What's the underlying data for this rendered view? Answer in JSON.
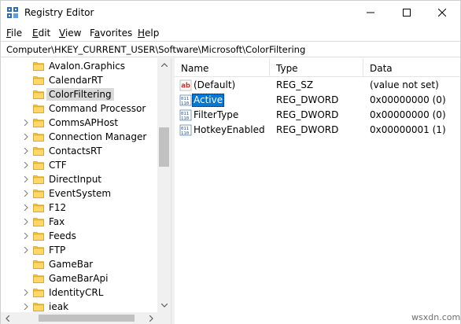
{
  "window": {
    "title": "Registry Editor",
    "icon": "registry-editor-icon"
  },
  "menu": [
    "File",
    "Edit",
    "View",
    "Favorites",
    "Help"
  ],
  "menu_mnemonics": [
    "F",
    "E",
    "V",
    "a",
    "H"
  ],
  "address": "Computer\\HKEY_CURRENT_USER\\Software\\Microsoft\\ColorFiltering",
  "tree": {
    "items": [
      {
        "label": "Avalon.Graphics",
        "expandable": false,
        "selected": false
      },
      {
        "label": "CalendarRT",
        "expandable": false,
        "selected": false
      },
      {
        "label": "ColorFiltering",
        "expandable": false,
        "selected": true
      },
      {
        "label": "Command Processor",
        "expandable": false,
        "selected": false
      },
      {
        "label": "CommsAPHost",
        "expandable": true,
        "selected": false
      },
      {
        "label": "Connection Manager",
        "expandable": true,
        "selected": false
      },
      {
        "label": "ContactsRT",
        "expandable": true,
        "selected": false
      },
      {
        "label": "CTF",
        "expandable": true,
        "selected": false
      },
      {
        "label": "DirectInput",
        "expandable": true,
        "selected": false
      },
      {
        "label": "EventSystem",
        "expandable": true,
        "selected": false
      },
      {
        "label": "F12",
        "expandable": true,
        "selected": false
      },
      {
        "label": "Fax",
        "expandable": true,
        "selected": false
      },
      {
        "label": "Feeds",
        "expandable": true,
        "selected": false
      },
      {
        "label": "FTP",
        "expandable": true,
        "selected": false
      },
      {
        "label": "GameBar",
        "expandable": false,
        "selected": false
      },
      {
        "label": "GameBarApi",
        "expandable": false,
        "selected": false
      },
      {
        "label": "IdentityCRL",
        "expandable": true,
        "selected": false
      },
      {
        "label": "ieak",
        "expandable": true,
        "selected": false
      }
    ]
  },
  "list": {
    "columns": [
      "Name",
      "Type",
      "Data"
    ],
    "rows": [
      {
        "name": "(Default)",
        "type": "REG_SZ",
        "data": "(value not set)",
        "icon": "string-value-icon",
        "selected": false
      },
      {
        "name": "Active",
        "type": "REG_DWORD",
        "data": "0x00000000 (0)",
        "icon": "binary-value-icon",
        "selected": true
      },
      {
        "name": "FilterType",
        "type": "REG_DWORD",
        "data": "0x00000000 (0)",
        "icon": "binary-value-icon",
        "selected": false
      },
      {
        "name": "HotkeyEnabled",
        "type": "REG_DWORD",
        "data": "0x00000001 (1)",
        "icon": "binary-value-icon",
        "selected": false
      }
    ]
  },
  "watermark": "wsxdn.com",
  "colors": {
    "selection": "#0078d7",
    "folder": "#f4c542",
    "tree_selection": "#d9d9d9",
    "scrollbar": "#f0f0f0"
  }
}
